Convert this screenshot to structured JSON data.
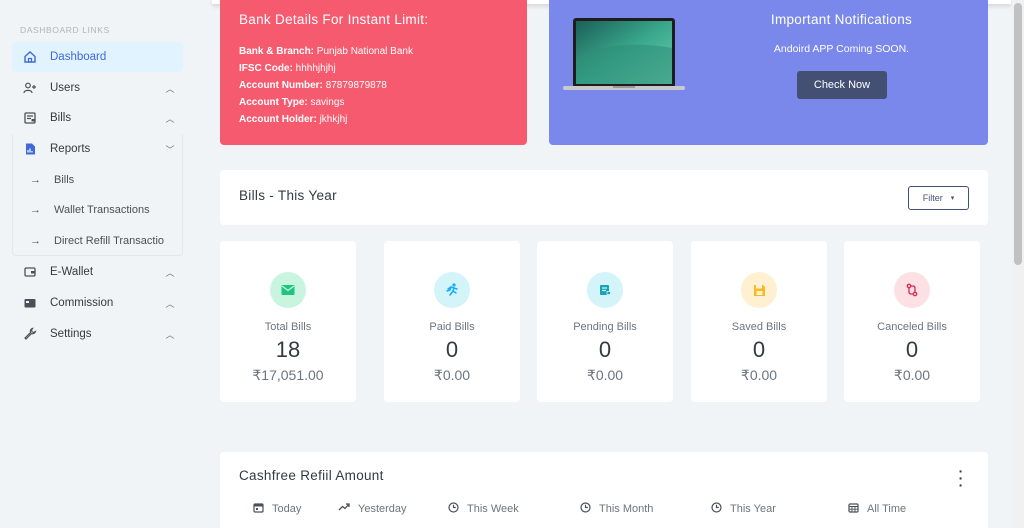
{
  "sidebar": {
    "header": "DASHBOARD LINKS",
    "items": [
      {
        "label": "Dashboard",
        "icon": "home-icon",
        "active": true
      },
      {
        "label": "Users",
        "icon": "user-plus-icon"
      },
      {
        "label": "Bills",
        "icon": "receipt-icon"
      },
      {
        "label": "Reports",
        "icon": "report-icon"
      },
      {
        "label": "E-Wallet",
        "icon": "wallet-icon"
      },
      {
        "label": "Commission",
        "icon": "card-icon"
      },
      {
        "label": "Settings",
        "icon": "wrench-icon"
      }
    ],
    "reports_subitems": [
      {
        "label": "Bills"
      },
      {
        "label": "Wallet Transactions"
      },
      {
        "label": "Direct Refill Transactio"
      }
    ]
  },
  "bank_card": {
    "title": "Bank Details For Instant Limit:",
    "rows": [
      {
        "key": "Bank & Branch:",
        "value": "Punjab National Bank"
      },
      {
        "key": "IFSC Code:",
        "value": "hhhhjhjhj"
      },
      {
        "key": "Account Number:",
        "value": "87879879878"
      },
      {
        "key": "Account Type:",
        "value": "savings"
      },
      {
        "key": "Account Holder:",
        "value": "jkhkjhj"
      }
    ],
    "color": "#f65a6e"
  },
  "notice_card": {
    "title": "Important Notifications",
    "message": "Andoird APP Coming SOON.",
    "button": "Check Now",
    "color": "#7a87eb"
  },
  "bills_section": {
    "title": "Bills - This Year",
    "filter_label": "Filter"
  },
  "stats": [
    {
      "label": "Total Bills",
      "count": "18",
      "amount": "₹17,051.00",
      "icon": "envelope-icon",
      "bg": "#c8f5e0",
      "fg": "#1ec47f"
    },
    {
      "label": "Paid Bills",
      "count": "0",
      "amount": "₹0.00",
      "icon": "running-icon",
      "bg": "#d3f4f8",
      "fg": "#16aaff"
    },
    {
      "label": "Pending Bills",
      "count": "0",
      "amount": "₹0.00",
      "icon": "receipt-icon",
      "bg": "#d3f4f8",
      "fg": "#17a2b8"
    },
    {
      "label": "Saved Bills",
      "count": "0",
      "amount": "₹0.00",
      "icon": "save-icon",
      "bg": "#fff0d1",
      "fg": "#f7b924"
    },
    {
      "label": "Canceled Bills",
      "count": "0",
      "amount": "₹0.00",
      "icon": "cancel-icon",
      "bg": "#fde0e3",
      "fg": "#d92550"
    }
  ],
  "cashfree": {
    "title": "Cashfree Refiil Amount",
    "tabs": [
      {
        "label": "Today",
        "icon": "calendar-icon"
      },
      {
        "label": "Yesterday",
        "icon": "trend-icon"
      },
      {
        "label": "This Week",
        "icon": "clock-icon"
      },
      {
        "label": "This Month",
        "icon": "clock-icon"
      },
      {
        "label": "This Year",
        "icon": "clock-icon"
      },
      {
        "label": "All Time",
        "icon": "calendar-icon"
      }
    ]
  }
}
